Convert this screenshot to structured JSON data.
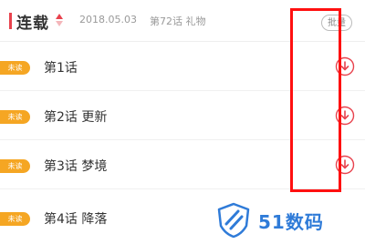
{
  "header": {
    "title": "连载",
    "date": "2018.05.03",
    "latest": "第72话 礼物",
    "batch_label": "批量"
  },
  "chapters": [
    {
      "badge": "未读",
      "title": "第1话"
    },
    {
      "badge": "未读",
      "title": "第2话 更新"
    },
    {
      "badge": "未读",
      "title": "第3话 梦境"
    },
    {
      "badge": "未读",
      "title": "第4话 降落"
    }
  ],
  "watermark": {
    "text": "51数码"
  },
  "colors": {
    "accent": "#e8424d",
    "badge": "#f5a623",
    "highlight": "#ff1010",
    "watermark": "#2f7bd8"
  },
  "icons": {
    "sort": "sort-triangles-icon",
    "download": "download-circle-icon"
  }
}
